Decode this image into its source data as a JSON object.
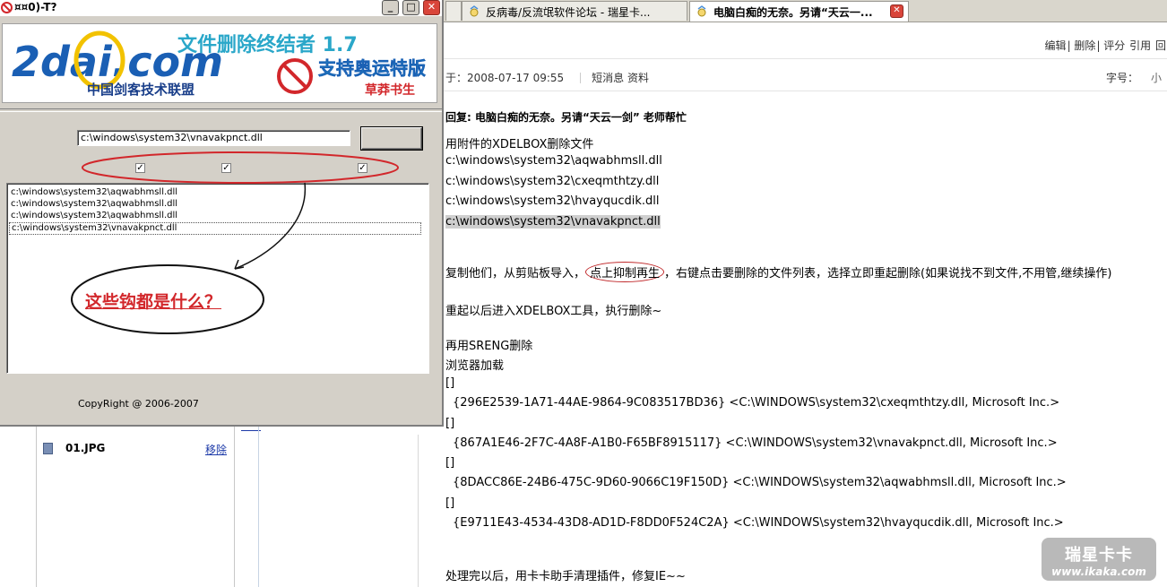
{
  "browser": {
    "tabs": [
      {
        "label": "反病毒/反流氓软件论坛 - 瑞星卡...",
        "active": false
      },
      {
        "label": "电脑白痴的无奈。另请“天云一...",
        "active": true
      }
    ]
  },
  "post": {
    "op_links": [
      "编辑",
      "删除",
      "评分",
      "引用",
      "回"
    ],
    "meta_prefix": "于：",
    "post_time": "2008-07-17 09:55",
    "meta_links": [
      "短消息",
      "资料"
    ],
    "font_label": "字号：",
    "font_small": "小",
    "title": "回复: 电脑白痴的无奈。另请“天云一剑” 老师帮忙",
    "lines": [
      "用附件的XDELBOX删除文件",
      "c:\\windows\\system32\\aqwabhmsll.dll",
      "c:\\windows\\system32\\cxeqmthtzy.dll",
      "c:\\windows\\system32\\hvayqucdik.dll",
      "c:\\windows\\system32\\vnavakpnct.dll"
    ],
    "instr_pre": "复制他们，从剪贴板导入，",
    "instr_circled": "点上抑制再生",
    "instr_post": "，右键点击要删除的文件列表，选择立即重起删除(如果说找不到文件,不用管,继续操作)",
    "reboot": "重起以后进入XDELBOX工具，执行删除~",
    "sreng": "再用SRENG删除",
    "bho": "浏览器加载",
    "bracket": "[]",
    "clsids": [
      "{296E2539-1A71-44AE-9864-9C083517BD36} <C:\\WINDOWS\\system32\\cxeqmthtzy.dll, Microsoft Inc.>",
      "{867A1E46-2F7C-4A8F-A1B0-F65BF8915117} <C:\\WINDOWS\\system32\\vnavakpnct.dll, Microsoft Inc.>",
      "{8DACC86E-24B6-475C-9D60-9066C19F150D} <C:\\WINDOWS\\system32\\aqwabhmsll.dll, Microsoft Inc.>",
      "{E9711E43-4534-43D8-AD1D-F8DD0F524C2A} <C:\\WINDOWS\\system32\\hvayqucdik.dll, Microsoft Inc.>"
    ],
    "final": "处理完以后，用卡卡助手清理插件，修复IE~~"
  },
  "attachment": {
    "name": "01.JPG",
    "remove": "移除"
  },
  "watermark": {
    "brand": "瑞星卡卡",
    "url": "www.ikaka.com"
  },
  "app": {
    "title": "¤¤0)-T?",
    "banner_logo": "2dai.com",
    "banner_org": "中国剑客技术联盟",
    "banner_product": "文件删除终结者 1.7",
    "banner_edition": "支持奥运特版",
    "banner_author": "草莽书生",
    "path_value": "c:\\windows\\system32\\vnavakpnct.dll",
    "checkbox_mark": "✓",
    "checked": [
      true,
      true,
      true
    ],
    "files": [
      "c:\\windows\\system32\\aqwabhmsll.dll",
      "c:\\windows\\system32\\aqwabhmsll.dll",
      "c:\\windows\\system32\\aqwabhmsll.dll",
      "c:\\windows\\system32\\vnavakpnct.dll"
    ],
    "copyright": "CopyRight @ 2006-2007"
  },
  "annotation": {
    "question": "这些钩都是什么？",
    "color": "#d2272b"
  },
  "colors": {
    "window_face": "#d4d0c8",
    "logo_blue": "#1a5fb4",
    "logo_yellow": "#f2c200",
    "banner_cyan": "#2aa7c9",
    "banner_red": "#d2272b"
  }
}
